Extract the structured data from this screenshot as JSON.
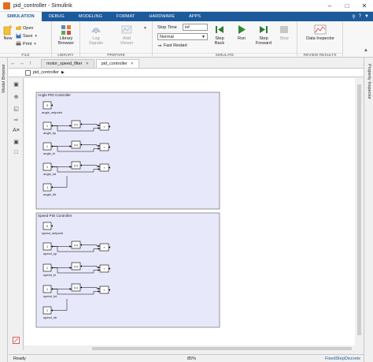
{
  "window": {
    "title": "pid_controller - Simulink"
  },
  "ribbon_tabs": [
    "SIMULATION",
    "DEBUG",
    "MODELING",
    "FORMAT",
    "HARDWARE",
    "APPS"
  ],
  "ribbon": {
    "file": {
      "group_label": "FILE",
      "new_label": "New",
      "open_label": "Open",
      "save_label": "Save",
      "print_label": "Print"
    },
    "library": {
      "group_label": "LIBRARY",
      "browser_label": "Library Browser"
    },
    "prepare": {
      "group_label": "PREPARE",
      "log_signals_label": "Log Signals",
      "add_viewer_label": "Add Viewer"
    },
    "simulate": {
      "group_label": "SIMULATE",
      "stop_time_label": "Stop Time",
      "stop_time_value": "inf",
      "mode_value": "Normal",
      "fast_restart_label": "Fast Restart",
      "step_back_label": "Step Back",
      "run_label": "Run",
      "step_forward_label": "Step Forward",
      "stop_label": "Stop"
    },
    "review": {
      "group_label": "REVIEW RESULTS",
      "data_inspector_label": "Data Inspector"
    }
  },
  "docks": {
    "left_label": "Model Browser",
    "right_label": "Property Inspector"
  },
  "editor": {
    "tabs": [
      "motor_speed_filter",
      "pid_controller"
    ],
    "breadcrumb": "pid_controller"
  },
  "diagram": {
    "subsystems": [
      {
        "title": "Angle PID Controller",
        "setpoint_value": "0",
        "setpoint_label": "angle_setpoint",
        "gains": [
          {
            "value": "1",
            "label": "angle_kp"
          },
          {
            "value": "1",
            "label": "angle_ki"
          },
          {
            "value": "1",
            "label": "angle_kd"
          },
          {
            "value": "-1",
            "label": "angle_tilt"
          }
        ]
      },
      {
        "title": "Speed PID Controller",
        "setpoint_value": "0",
        "setpoint_label": "speed_setpoint",
        "gains": [
          {
            "value": "1",
            "label": "speed_kp"
          },
          {
            "value": "1",
            "label": "speed_ki"
          },
          {
            "value": "1",
            "label": "speed_kd"
          },
          {
            "value": "1",
            "label": "speed_dir"
          }
        ]
      }
    ],
    "abs_symbol": "|u|",
    "product_symbol": "×"
  },
  "statusbar": {
    "ready": "Ready",
    "zoom": "85%",
    "solver": "FixedStepDiscrete"
  },
  "colors": {
    "ribbon_blue": "#1c5a9c",
    "subsystem_fill": "#e8e8fb"
  }
}
